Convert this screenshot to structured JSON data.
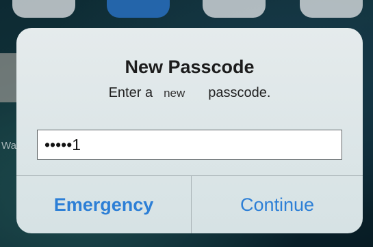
{
  "background": {
    "side_label": "Wa"
  },
  "alert": {
    "title": "New Passcode",
    "message_before": "Enter a",
    "message_word": "new",
    "message_after": "passcode.",
    "passcode_value": "•••••1",
    "buttons": {
      "emergency_label": "Emergency",
      "continue_label": "Continue"
    },
    "accent_color": "#2d7fd6"
  }
}
